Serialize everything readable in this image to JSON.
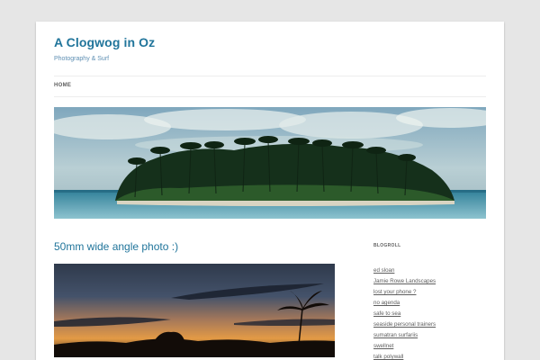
{
  "site": {
    "title": "A Clogwog in Oz",
    "description": "Photography & Surf"
  },
  "nav": {
    "items": [
      {
        "label": "HOME"
      }
    ]
  },
  "post": {
    "title": "50mm wide angle photo :)"
  },
  "sidebar": {
    "heading": "BLOGROLL",
    "links": [
      {
        "label": "ed sloan"
      },
      {
        "label": "Jamie Rowe Landscapes"
      },
      {
        "label": "lost your phone ?"
      },
      {
        "label": "no agenda"
      },
      {
        "label": "safe to sea"
      },
      {
        "label": "seaside personal trainers"
      },
      {
        "label": "sumatran surfariis"
      },
      {
        "label": "swellnet"
      },
      {
        "label": "talk polywall"
      }
    ]
  },
  "colors": {
    "background": "#e6e6e6",
    "page": "#ffffff",
    "link": "#21759b",
    "text": "#5e5e5e"
  }
}
